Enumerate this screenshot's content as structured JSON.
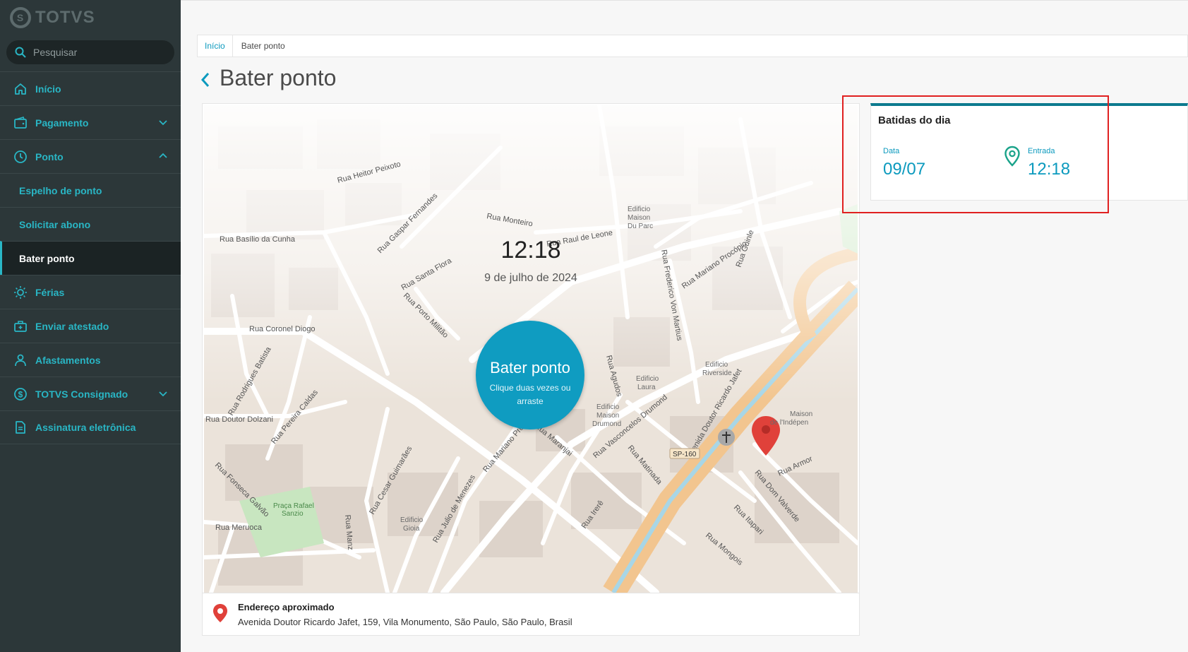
{
  "sidebar": {
    "logo_text": "TOTVS",
    "search_placeholder": "Pesquisar",
    "items": [
      {
        "label": "Início"
      },
      {
        "label": "Pagamento"
      },
      {
        "label": "Ponto"
      },
      {
        "label": "Espelho de ponto"
      },
      {
        "label": "Solicitar abono"
      },
      {
        "label": "Bater ponto"
      },
      {
        "label": "Férias"
      },
      {
        "label": "Enviar atestado"
      },
      {
        "label": "Afastamentos"
      },
      {
        "label": "TOTVS Consignado"
      },
      {
        "label": "Assinatura eletrônica"
      }
    ]
  },
  "breadcrumb": {
    "home": "Início",
    "current": "Bater ponto"
  },
  "page_title": "Bater ponto",
  "map": {
    "time": "12:18",
    "date": "9 de julho de 2024",
    "button_label": "Bater ponto",
    "button_hint": "Clique duas vezes ou arraste",
    "streets": [
      "Rua Heitor Peixoto",
      "Rua Basílio da Cunha",
      "Rua Gaspar Fernandes",
      "Rua Monteiro",
      "Rua Raul de Leone",
      "Rua Santa Flora",
      "Rua Porto Militão",
      "Rua Coronel Diogo",
      "Rua Rodrigues Batista",
      "Rua Pereira Caldas",
      "Rua Doutor Dolzani",
      "Rua Fonseca Galvão",
      "Rua Meruoca",
      "Rua Cesar Guimarães",
      "Rua Julio de Menezes",
      "Rua Mariano Procópio",
      "Rua Maranjai",
      "Rua Vasconcelos Drumond",
      "Rua Agudos",
      "Rua Frederico Von Martius",
      "Avenida Doutor Ricardo Jafet",
      "Rua Itapari",
      "Rua Dom Valverde",
      "Rua Mongois",
      "Rua Irerê",
      "Rua Matinada",
      "Rua Guinle",
      "Rua Mariano Procópio",
      "Rua Manz",
      "Rua Armor"
    ],
    "places": [
      "Edificio Maison Du Parc",
      "Edificio Riverside",
      "Edificio Laura",
      "Edificio Maison Drumond",
      "Edificio Gioia",
      "Praça Rafael Sanzio",
      "Maison de l'Indépen",
      "SP-160"
    ]
  },
  "address": {
    "label": "Endereço aproximado",
    "text": "Avenida Doutor Ricardo Jafet, 159, Vila Monumento, São Paulo, São Paulo, Brasil"
  },
  "batidas": {
    "title": "Batidas do dia",
    "data_label": "Data",
    "data_value": "09/07",
    "entrada_label": "Entrada",
    "entrada_value": "12:18"
  },
  "colors": {
    "accent": "#0f9cc1",
    "sidebar": "#2c3739",
    "highlight_box": "#e02020",
    "pin": "#e0413a"
  }
}
